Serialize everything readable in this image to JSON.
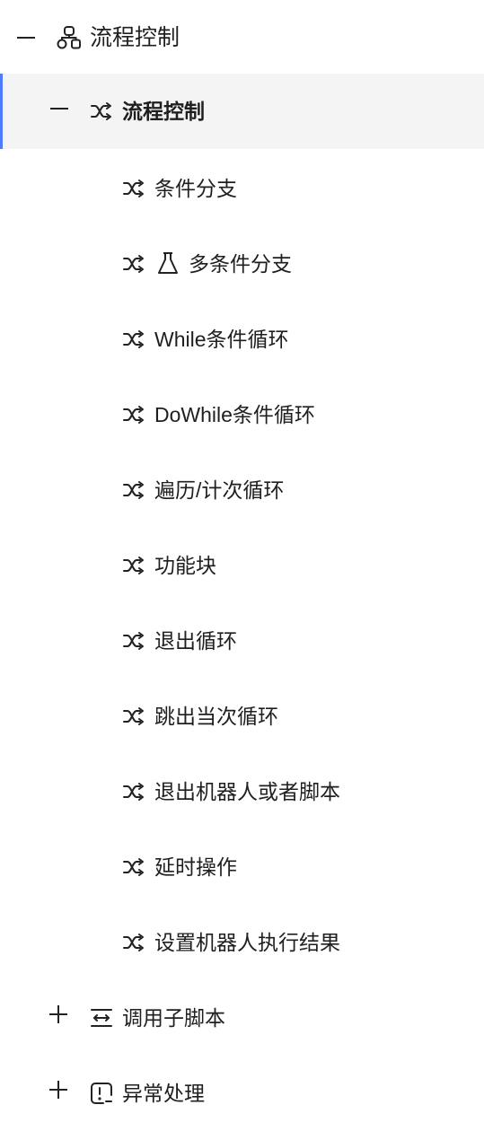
{
  "tree": {
    "root": {
      "toggle": "collapse",
      "icon": "org-chart-icon",
      "label": "流程控制"
    },
    "group": {
      "toggle": "collapse",
      "icon": "shuffle-icon",
      "label": "流程控制",
      "selected": true
    },
    "items": [
      {
        "icon": "shuffle-icon",
        "label": "条件分支"
      },
      {
        "icon": "shuffle-icon",
        "extra_icon": "flask-icon",
        "label": "多条件分支"
      },
      {
        "icon": "shuffle-icon",
        "label": "While条件循环"
      },
      {
        "icon": "shuffle-icon",
        "label": "DoWhile条件循环"
      },
      {
        "icon": "shuffle-icon",
        "label": "遍历/计次循环"
      },
      {
        "icon": "shuffle-icon",
        "label": "功能块"
      },
      {
        "icon": "shuffle-icon",
        "label": "退出循环"
      },
      {
        "icon": "shuffle-icon",
        "label": "跳出当次循环"
      },
      {
        "icon": "shuffle-icon",
        "label": "退出机器人或者脚本"
      },
      {
        "icon": "shuffle-icon",
        "label": "延时操作"
      },
      {
        "icon": "shuffle-icon",
        "label": "设置机器人执行结果"
      }
    ],
    "collapsed_groups": [
      {
        "toggle": "expand",
        "icon": "sub-script-icon",
        "label": "调用子脚本"
      },
      {
        "toggle": "expand",
        "icon": "exception-icon",
        "label": "异常处理"
      }
    ]
  },
  "colors": {
    "selected_bg": "#f4f4f5",
    "selected_accent": "#4f7cff",
    "text": "#1f1f1f"
  }
}
